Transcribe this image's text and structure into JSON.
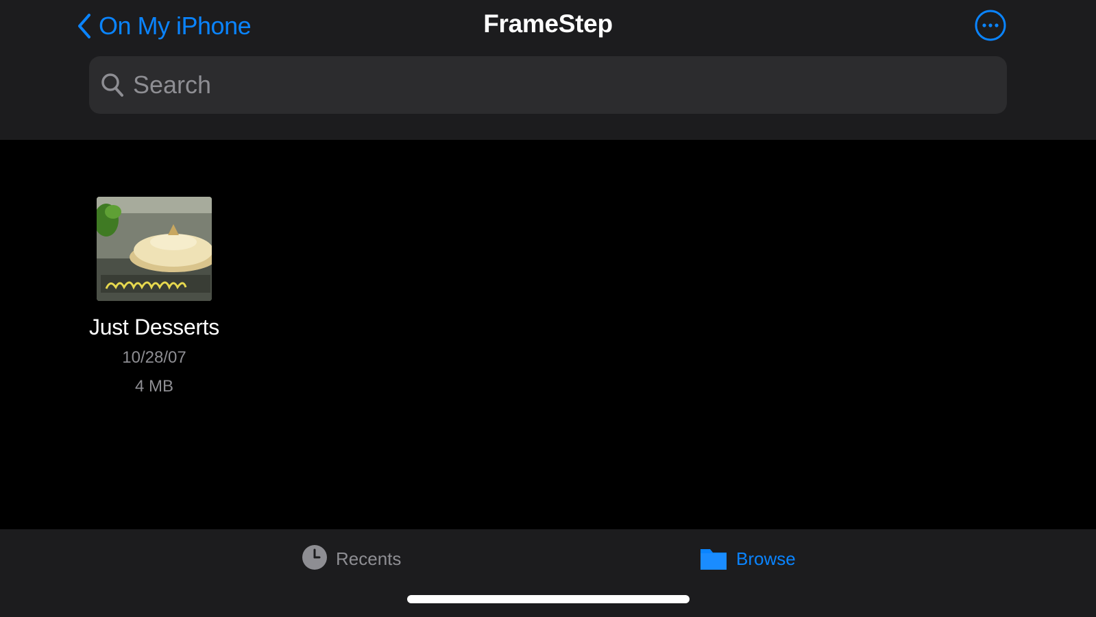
{
  "nav": {
    "back_label": "On My iPhone",
    "title": "FrameStep"
  },
  "search": {
    "placeholder": "Search",
    "value": ""
  },
  "files": [
    {
      "name": "Just Desserts",
      "date": "10/28/07",
      "size": "4 MB",
      "thumbnail_icon": "video-thumbnail"
    }
  ],
  "tab_bar": {
    "tabs": [
      {
        "label": "Recents",
        "icon": "clock-icon",
        "selected": false
      },
      {
        "label": "Browse",
        "icon": "folder-icon",
        "selected": true
      }
    ]
  },
  "colors": {
    "accent": "#0a84ff",
    "background": "#000000",
    "bar_background": "#1c1c1e",
    "search_field": "#2c2c2e",
    "secondary_text": "#8e8e93"
  }
}
